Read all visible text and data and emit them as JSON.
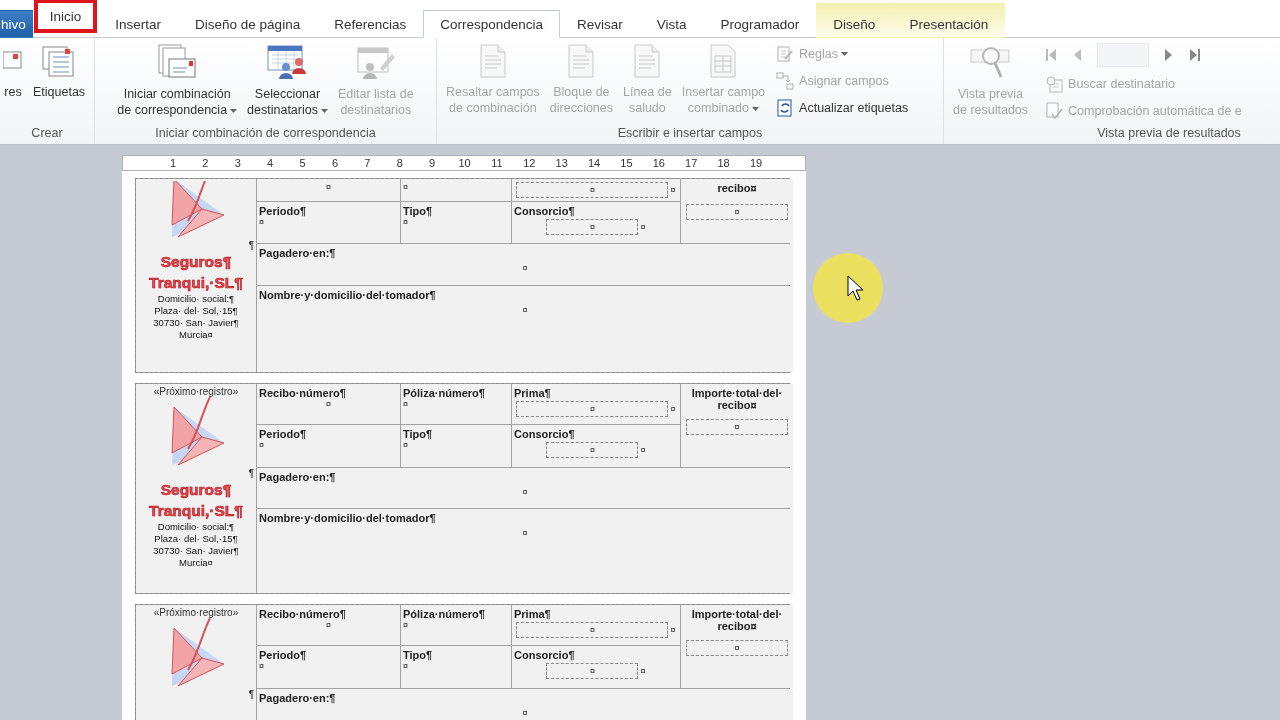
{
  "tabs": [
    {
      "label": "hivo",
      "kind": "file",
      "selected": false,
      "highlighted": false
    },
    {
      "label": "Inicio",
      "kind": "normal",
      "selected": false,
      "highlighted": true
    },
    {
      "label": "Insertar",
      "kind": "normal",
      "selected": false,
      "highlighted": false
    },
    {
      "label": "Diseño de página",
      "kind": "normal",
      "selected": false,
      "highlighted": false
    },
    {
      "label": "Referencias",
      "kind": "normal",
      "selected": false,
      "highlighted": false
    },
    {
      "label": "Correspondencia",
      "kind": "normal",
      "selected": true,
      "highlighted": false
    },
    {
      "label": "Revisar",
      "kind": "normal",
      "selected": false,
      "highlighted": false
    },
    {
      "label": "Vista",
      "kind": "normal",
      "selected": false,
      "highlighted": false
    },
    {
      "label": "Programador",
      "kind": "normal",
      "selected": false,
      "highlighted": false
    },
    {
      "label": "Diseño",
      "kind": "contextual",
      "selected": false,
      "highlighted": false
    },
    {
      "label": "Presentación",
      "kind": "contextual",
      "selected": false,
      "highlighted": false
    }
  ],
  "groups": [
    {
      "label": "Crear",
      "kind": "basic",
      "large": [
        {
          "lines": [
            "res"
          ],
          "disabled": false,
          "dropdown": false
        },
        {
          "lines": [
            "Etiquetas"
          ],
          "disabled": false,
          "dropdown": false
        }
      ]
    },
    {
      "label": "Iniciar combinación de correspondencia",
      "kind": "basic",
      "large": [
        {
          "lines": [
            "Iniciar combinación",
            "de correspondencia"
          ],
          "disabled": false,
          "dropdown": true
        },
        {
          "lines": [
            "Seleccionar",
            "destinatarios"
          ],
          "disabled": false,
          "dropdown": true
        },
        {
          "lines": [
            "Editar lista de",
            "destinatarios"
          ],
          "disabled": true,
          "dropdown": false
        }
      ]
    },
    {
      "label": "Escribir e insertar campos",
      "kind": "fields",
      "large": [
        {
          "lines": [
            "Resaltar campos",
            "de combinación"
          ],
          "disabled": true,
          "dropdown": false
        },
        {
          "lines": [
            "Bloque de",
            "direcciones"
          ],
          "disabled": true,
          "dropdown": false
        },
        {
          "lines": [
            "Línea de",
            "saludo"
          ],
          "disabled": true,
          "dropdown": false
        },
        {
          "lines": [
            "Insertar campo",
            "combinado"
          ],
          "disabled": true,
          "dropdown": true
        }
      ],
      "small": [
        {
          "label": "Reglas",
          "disabled": true,
          "dropdown": true
        },
        {
          "label": "Asignar campos",
          "disabled": true,
          "dropdown": false
        },
        {
          "label": "Actualizar etiquetas",
          "disabled": false,
          "dropdown": false
        }
      ]
    },
    {
      "label": "Vista previa de resultados",
      "kind": "preview",
      "large": [
        {
          "lines": [
            "Vista previa",
            "de resultados"
          ],
          "disabled": true,
          "dropdown": false
        }
      ],
      "small": [
        {
          "label": "Buscar destinatario",
          "disabled": true,
          "dropdown": false
        },
        {
          "label": "Comprobación automática de e",
          "disabled": true,
          "dropdown": false
        }
      ]
    }
  ],
  "ruler": [
    "1",
    "2",
    "3",
    "4",
    "5",
    "6",
    "7",
    "8",
    "9",
    "10",
    "11",
    "12",
    "13",
    "14",
    "15",
    "16",
    "17",
    "18",
    "19"
  ],
  "cards": [
    {
      "cut_top": true,
      "logo": {
        "mark": "¶",
        "lines": [
          "Seguros¶",
          "Tranqui,·SL¶"
        ],
        "address": [
          "Domicilio· social:¶",
          "Plaza· del· Sol,·15¶",
          "30730· San· Javier¶",
          "Murcia¤"
        ]
      },
      "cells": [
        {
          "kind": "label",
          "value": "¤"
        },
        {
          "kind": "label",
          "value": "¤"
        },
        {
          "kind": "field",
          "value": "¤",
          "end": "¤"
        },
        {
          "kind": "total",
          "label": "recibo¤",
          "value": "¤"
        },
        {
          "kind": "label",
          "label": "Periodo¶",
          "value": "¤"
        },
        {
          "kind": "label",
          "label": "Tipo¶",
          "value": "¤"
        },
        {
          "kind": "field",
          "label": "Consorcio¶",
          "value": "¤",
          "end": "¤"
        },
        {
          "kind": "wide",
          "label": "Pagadero·en:¶",
          "value": "¤"
        },
        {
          "kind": "wide",
          "label": "Nombre·y·domicilio·del·tomador¶",
          "value": "¤"
        }
      ]
    },
    {
      "cut_top": false,
      "record": "«Próximo·registro»",
      "logo": {
        "mark": "¶",
        "lines": [
          "Seguros¶",
          "Tranqui,·SL¶"
        ],
        "address": [
          "Domicilio· social:¶",
          "Plaza· del· Sol,·15¶",
          "30730· San· Javier¶",
          "Murcia¤"
        ]
      },
      "cells": [
        {
          "kind": "label",
          "label": "Recibo·número¶",
          "value": "¤"
        },
        {
          "kind": "label",
          "label": "Póliza·número¶",
          "value": "¤"
        },
        {
          "kind": "field",
          "label": "Prima¶",
          "value": "¤",
          "end": "¤"
        },
        {
          "kind": "total",
          "label": "Importe·total·del· recibo¤",
          "value": "¤"
        },
        {
          "kind": "label",
          "label": "Periodo¶",
          "value": "¤"
        },
        {
          "kind": "label",
          "label": "Tipo¶",
          "value": "¤"
        },
        {
          "kind": "field",
          "label": "Consorcio¶",
          "value": "¤",
          "end": "¤"
        },
        {
          "kind": "wide",
          "label": "Pagadero·en:¶",
          "value": "¤"
        },
        {
          "kind": "wide",
          "label": "Nombre·y·domicilio·del·tomador¶",
          "value": "¤"
        }
      ]
    },
    {
      "cut_top": false,
      "record": "«Próximo·registro»",
      "logo": {
        "mark": "¶"
      },
      "cells": [
        {
          "kind": "label",
          "label": "Recibo·número¶",
          "value": "¤"
        },
        {
          "kind": "label",
          "label": "Póliza·número¶",
          "value": "¤"
        },
        {
          "kind": "field",
          "label": "Prima¶",
          "value": "¤",
          "end": "¤"
        },
        {
          "kind": "total",
          "label": "Importe·total·del· recibo¤",
          "value": "¤"
        },
        {
          "kind": "label",
          "label": "Periodo¶",
          "value": "¤"
        },
        {
          "kind": "label",
          "label": "Tipo¶",
          "value": "¤"
        },
        {
          "kind": "field",
          "label": "Consorcio¶",
          "value": "¤",
          "end": "¤"
        },
        {
          "kind": "wide",
          "label": "Pagadero·en:¶",
          "value": "¤"
        }
      ]
    }
  ]
}
